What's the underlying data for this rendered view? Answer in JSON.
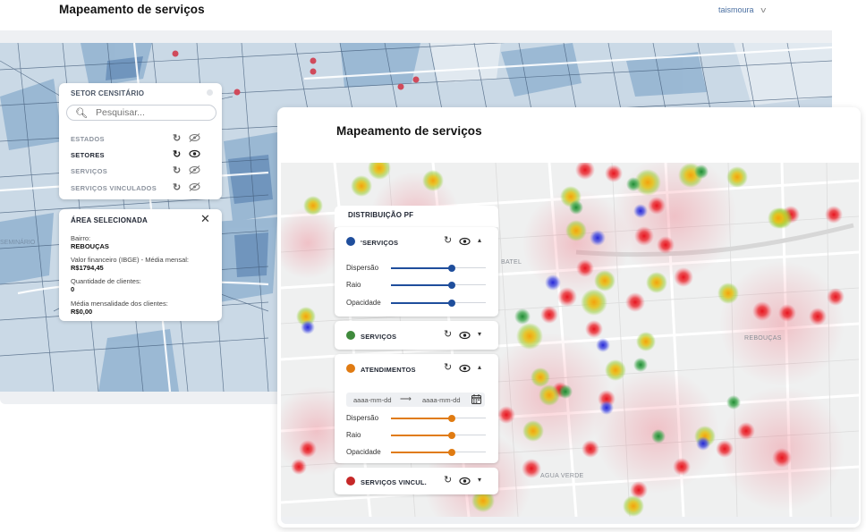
{
  "back_window": {
    "app_title": "Mapeamento de serviços",
    "user": "taismoura"
  },
  "setor_panel": {
    "title": "SETOR CENSITÁRIO",
    "search_placeholder": "Pesquisar...",
    "layers": [
      {
        "label": "ESTADOS",
        "active": false,
        "visible": false
      },
      {
        "label": "SETORES",
        "active": true,
        "visible": true
      },
      {
        "label": "SERVIÇOS",
        "active": false,
        "visible": false
      },
      {
        "label": "SERVIÇOS VINCULADOS",
        "active": false,
        "visible": false
      }
    ]
  },
  "area_panel": {
    "title": "ÁREA SELECIONADA",
    "fields": [
      {
        "label": "Bairro:",
        "value": "REBOUÇAS"
      },
      {
        "label": "Valor financeiro (IBGE) - Média mensal:",
        "value": "R$1794,45"
      },
      {
        "label": "Quantidade de clientes:",
        "value": "0"
      },
      {
        "label": "Média mensalidade dos clientes:",
        "value": "R$0,00"
      }
    ]
  },
  "front_window": {
    "app_title": "Mapeamento de serviços",
    "panel_title": "DISTRIBUIÇÃO PF",
    "cards": [
      {
        "name": "'SERVIÇOS",
        "color": "#1f4e9c",
        "expanded": true,
        "sliders": [
          {
            "label": "Dispersão",
            "value": 0.64
          },
          {
            "label": "Raio",
            "value": 0.64
          },
          {
            "label": "Opacidade",
            "value": 0.64
          }
        ]
      },
      {
        "name": "SERVIÇOS",
        "color": "#3f8a3c",
        "expanded": false
      },
      {
        "name": "ATENDIMENTOS",
        "color": "#e07b12",
        "expanded": true,
        "date_from": "aaaa-mm-dd",
        "date_to": "aaaa-mm-dd",
        "sliders": [
          {
            "label": "Dispersão",
            "value": 0.64
          },
          {
            "label": "Raio",
            "value": 0.64
          },
          {
            "label": "Opacidade",
            "value": 0.64
          }
        ]
      },
      {
        "name": "SERVIÇOS VINCUL.",
        "color": "#c62828",
        "expanded": false
      }
    ],
    "map_labels": [
      "REBOUÇAS",
      "AGUA VERDE",
      "BATEL"
    ]
  },
  "colors": {
    "accent_blue": "#1f4e9c",
    "accent_orange": "#e07b12",
    "accent_green": "#3f8a3c",
    "accent_red": "#c62828"
  }
}
